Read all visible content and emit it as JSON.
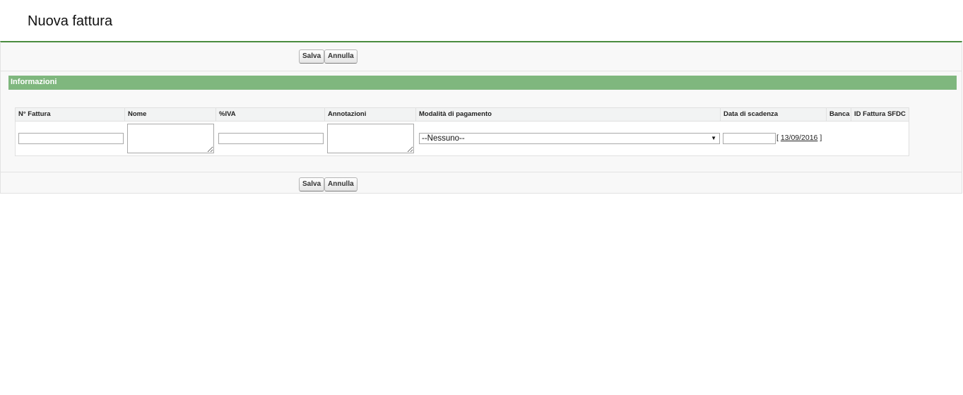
{
  "page": {
    "title": "Nuova fattura"
  },
  "toolbar": {
    "save_label": "Salva",
    "cancel_label": "Annulla"
  },
  "section": {
    "title": "Informazioni"
  },
  "grid": {
    "headers": [
      "N° Fattura",
      "Nome",
      "%IVA",
      "Annotazioni",
      "Modalità di pagamento",
      "Data di scadenza",
      "Banca",
      "ID Fattura SFDC"
    ]
  },
  "fields": {
    "numero_fattura": {
      "value": ""
    },
    "nome": {
      "value": ""
    },
    "iva": {
      "value": ""
    },
    "annotazioni": {
      "value": ""
    },
    "modalita_pagamento": {
      "selected": "--Nessuno--"
    },
    "data_scadenza": {
      "value": "",
      "today_prefix": "[",
      "today_date": "13/09/2016",
      "today_suffix": "]"
    }
  },
  "colors": {
    "accent_line": "#4a8c3f",
    "section_header": "#7fb77e"
  }
}
